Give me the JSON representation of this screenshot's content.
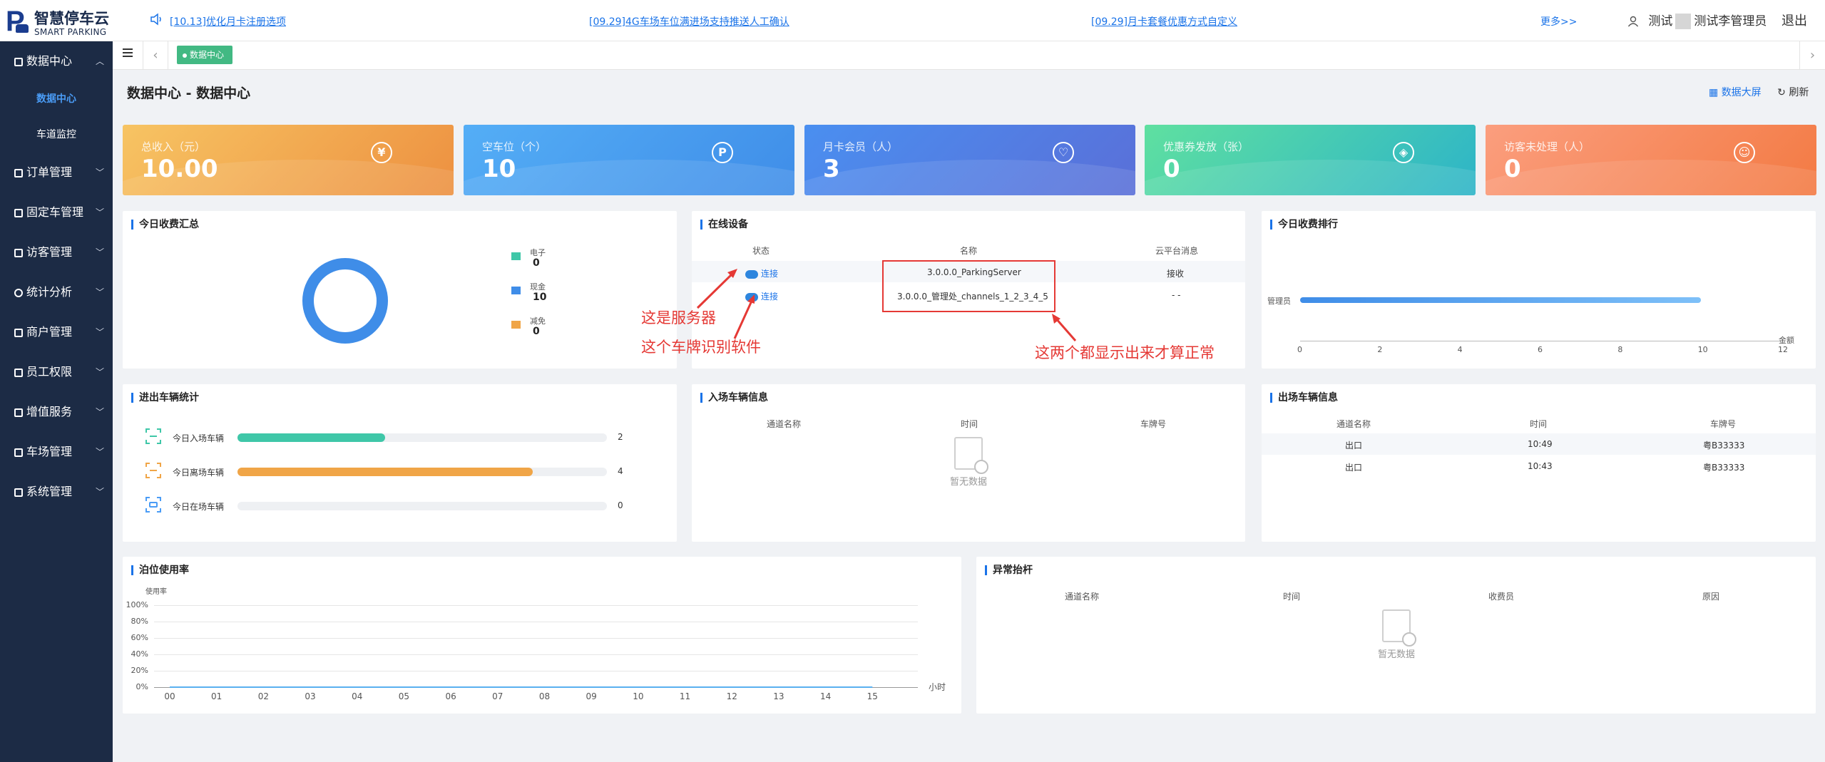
{
  "app": {
    "name": "智慧停车云",
    "subtitle": "SMART PARKING"
  },
  "notices": [
    "[10.13]优化月卡注册选项",
    "[09.29]4G车场车位满进场支持推送人工确认",
    "[09.29]月卡套餐优惠方式自定义"
  ],
  "header": {
    "more": "更多>>",
    "user": "测试",
    "user_full": "测试李管理员",
    "logout": "退出"
  },
  "sidebar": {
    "items": [
      {
        "label": "数据中心",
        "expanded": true
      },
      {
        "label": "订单管理"
      },
      {
        "label": "固定车管理"
      },
      {
        "label": "访客管理"
      },
      {
        "label": "统计分析"
      },
      {
        "label": "商户管理"
      },
      {
        "label": "员工权限"
      },
      {
        "label": "增值服务"
      },
      {
        "label": "车场管理"
      },
      {
        "label": "系统管理"
      }
    ],
    "sub": [
      {
        "label": "数据中心",
        "active": true
      },
      {
        "label": "车道监控"
      }
    ]
  },
  "tabs": [
    {
      "label": "数据中心"
    }
  ],
  "page": {
    "title": "数据中心 - 数据中心",
    "big_screen": "数据大屏",
    "refresh": "刷新"
  },
  "stats": [
    {
      "label": "总收入（元）",
      "value": "10.00",
      "icon": "yen-icon",
      "color": "#f0a547"
    },
    {
      "label": "空车位（个）",
      "value": "10",
      "icon": "parking-icon",
      "color": "#4a9cf6"
    },
    {
      "label": "月卡会员（人）",
      "value": "3",
      "icon": "heart-icon",
      "color": "#4b7fe6"
    },
    {
      "label": "优惠券发放（张）",
      "value": "0",
      "icon": "coupon-icon",
      "color": "#3fc7a8"
    },
    {
      "label": "访客未处理（人）",
      "value": "0",
      "icon": "visitor-icon",
      "color": "#f58a5a"
    }
  ],
  "income_summary": {
    "title": "今日收费汇总",
    "legend": [
      {
        "name": "电子",
        "value": "0",
        "color": "#3fc7a8"
      },
      {
        "name": "现金",
        "value": "10",
        "color": "#3f8de8"
      },
      {
        "name": "减免",
        "value": "0",
        "color": "#f0a547"
      }
    ]
  },
  "online_devices": {
    "title": "在线设备",
    "headers": [
      "状态",
      "名称",
      "云平台消息"
    ],
    "rows": [
      {
        "status": "连接",
        "name": "3.0.0.0_ParkingServer",
        "msg": "接收"
      },
      {
        "status": "连接",
        "name": "3.0.0.0_管理处_channels_1_2_3_4_5",
        "msg": "- -"
      }
    ]
  },
  "annotations": {
    "server": "这是服务器",
    "plate": "这个车牌识别软件",
    "both": "这两个都显示出来才算正常"
  },
  "income_rank": {
    "title": "今日收费排行",
    "category": "管理员",
    "value": 10,
    "xticks": [
      "0",
      "2",
      "4",
      "6",
      "8",
      "10",
      "12"
    ],
    "xlabel": "金额"
  },
  "vehicle_stats": {
    "title": "进出车辆统计",
    "rows": [
      {
        "label": "今日入场车辆",
        "value": "2",
        "fraction": 0.4,
        "color": "#3fc7a8"
      },
      {
        "label": "今日离场车辆",
        "value": "4",
        "fraction": 0.8,
        "color": "#f0a547"
      },
      {
        "label": "今日在场车辆",
        "value": "0",
        "fraction": 0,
        "color": "#4a9cf6"
      }
    ]
  },
  "entry_info": {
    "title": "入场车辆信息",
    "headers": [
      "通道名称",
      "时间",
      "车牌号"
    ],
    "empty": "暂无数据"
  },
  "exit_info": {
    "title": "出场车辆信息",
    "headers": [
      "通道名称",
      "时间",
      "车牌号"
    ],
    "rows": [
      {
        "channel": "出口",
        "time": "10:49",
        "plate": "粤B33333"
      },
      {
        "channel": "出口",
        "time": "10:43",
        "plate": "粤B33333"
      }
    ]
  },
  "usage": {
    "title": "泊位使用率"
  },
  "abnormal": {
    "title": "异常抬杆",
    "headers": [
      "通道名称",
      "时间",
      "收费员",
      "原因"
    ],
    "empty": "暂无数据"
  },
  "chart_data": {
    "type": "line",
    "title": "",
    "ylabel": "使用率",
    "xlabel": "小时",
    "x": [
      "00",
      "01",
      "02",
      "03",
      "04",
      "05",
      "06",
      "07",
      "08",
      "09",
      "10",
      "11",
      "12",
      "13",
      "14",
      "15"
    ],
    "yticks": [
      "100%",
      "80%",
      "60%",
      "40%",
      "20%",
      "0%"
    ],
    "ylim": [
      0,
      100
    ],
    "series": [
      {
        "values": [
          0,
          0,
          0,
          0,
          0,
          0,
          0,
          0,
          0,
          0,
          0,
          0,
          0,
          0,
          0,
          0
        ]
      }
    ]
  }
}
